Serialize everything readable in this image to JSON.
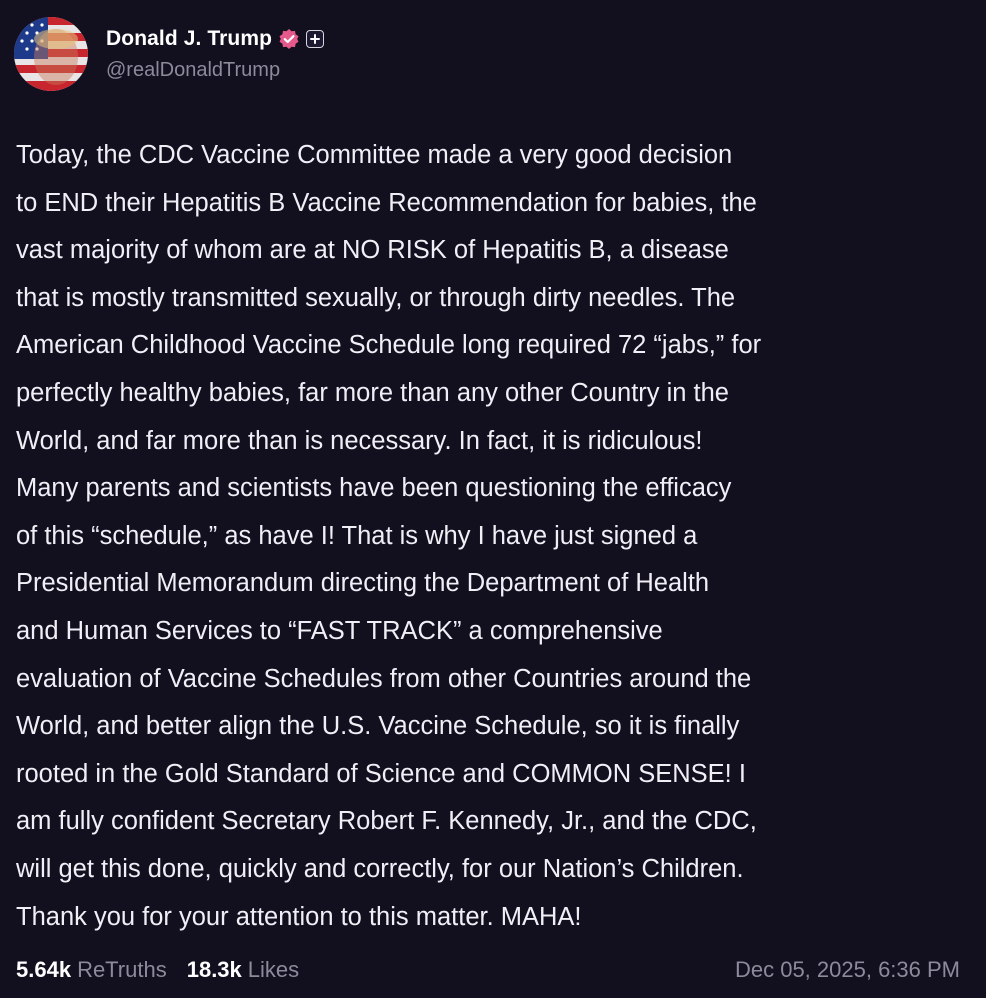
{
  "author": {
    "display_name": "Donald J. Trump",
    "handle": "@realDonaldTrump",
    "verified_icon": "verified-check-badge",
    "plus_icon": "plus-box",
    "verified_color": "#e55a8a"
  },
  "post": {
    "lines": [
      "Today, the CDC Vaccine Committee made a very good decision",
      "to END their Hepatitis B Vaccine Recommendation for babies, the",
      "vast majority of whom are at NO RISK of Hepatitis B, a disease",
      "that is mostly transmitted sexually, or through dirty needles. The",
      "American Childhood Vaccine Schedule long required 72 “jabs,” for",
      "perfectly healthy babies, far more than any other Country in the",
      "World, and far more than is necessary. In fact, it is ridiculous!",
      "Many parents and scientists have been questioning the efficacy",
      "of this “schedule,” as have I! That is why I have just signed a",
      "Presidential Memorandum directing the Department of Health",
      "and Human Services to “FAST TRACK” a comprehensive",
      "evaluation of Vaccine Schedules from other Countries around the",
      "World, and better align the U.S. Vaccine Schedule, so it is finally",
      "rooted in the Gold Standard of Science and COMMON SENSE! I",
      "am fully confident Secretary Robert F. Kennedy, Jr., and the CDC,",
      "will get this done, quickly and correctly, for our Nation’s Children.",
      "Thank you for your attention to this matter. MAHA!"
    ]
  },
  "stats": {
    "retruths_count": "5.64k",
    "retruths_label": "ReTruths",
    "likes_count": "18.3k",
    "likes_label": "Likes"
  },
  "timestamp": "Dec 05, 2025, 6:36 PM"
}
